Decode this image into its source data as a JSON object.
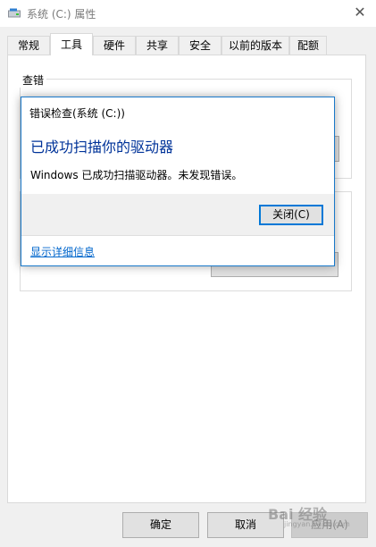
{
  "window": {
    "title": "系统 (C:) 属性",
    "close_glyph": "✕"
  },
  "tabs": [
    "常规",
    "工具",
    "硬件",
    "共享",
    "安全",
    "以前的版本",
    "配额"
  ],
  "active_tab": "工具",
  "group": {
    "label": "查错"
  },
  "dialog": {
    "title": "错误检查(系统 (C:))",
    "heading": "已成功扫描你的驱动器",
    "message": "Windows 已成功扫描驱动器。未发现错误。",
    "close_button": "关闭(C)",
    "details_link": "显示详细信息"
  },
  "buttons": {
    "ok": "确定",
    "cancel": "取消",
    "apply": "应用(A)"
  },
  "watermark": {
    "text": "Bai 经验",
    "sub": "jingyan.baidu.com"
  },
  "colors": {
    "dialog_border": "#1979ca",
    "heading": "#003399",
    "link": "#0066cc"
  }
}
